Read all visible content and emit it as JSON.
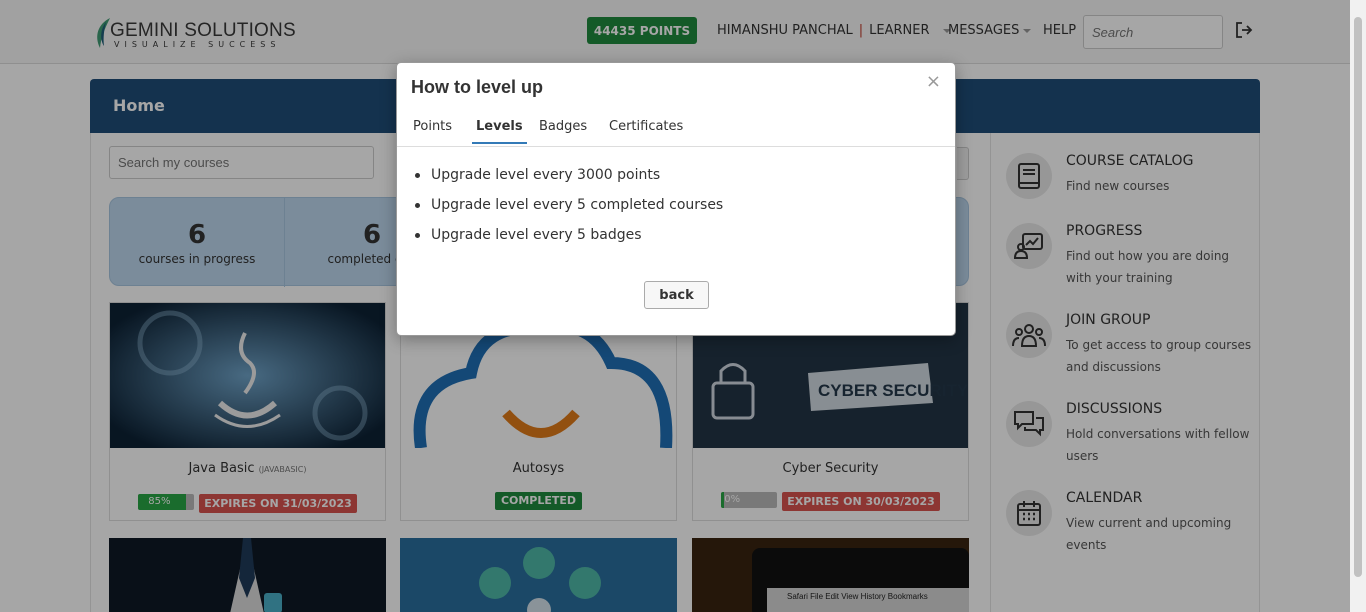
{
  "brand": {
    "name": "GEMINI SOLUTIONS",
    "tagline": "VISUALIZE SUCCESS"
  },
  "navbar": {
    "points_label": "44435 POINTS",
    "user_name": "HIMANSHU PANCHAL",
    "separator": "|",
    "user_role": "LEARNER",
    "messages_label": "MESSAGES",
    "help_label": "HELP",
    "search_placeholder": "Search"
  },
  "page": {
    "title": "Home",
    "course_search_placeholder": "Search my courses"
  },
  "stats": [
    {
      "value": "6",
      "label": "courses in progress"
    },
    {
      "value": "6",
      "label": "completed cou"
    }
  ],
  "courses": [
    {
      "title": "Java Basic",
      "code": "(JAVABASIC)",
      "progress_label": "85%",
      "progress": 0.85,
      "expiry": "EXPIRES ON 31/03/2023"
    },
    {
      "title": "Autosys",
      "status": "COMPLETED"
    },
    {
      "title": "Cyber Security",
      "progress_label": "0%",
      "progress": 0.0,
      "expiry": "EXPIRES ON 30/03/2023"
    }
  ],
  "sidebar": [
    {
      "icon": "book-icon",
      "title": "COURSE CATALOG",
      "desc": "Find new courses"
    },
    {
      "icon": "progress-chart-icon",
      "title": "PROGRESS",
      "desc": "Find out how you are doing with your training"
    },
    {
      "icon": "group-icon",
      "title": "JOIN GROUP",
      "desc": "To get access to group courses and discussions"
    },
    {
      "icon": "chat-bubbles-icon",
      "title": "DISCUSSIONS",
      "desc": "Hold conversations with fellow users"
    },
    {
      "icon": "calendar-icon",
      "title": "CALENDAR",
      "desc": "View current and upcoming events"
    }
  ],
  "modal": {
    "title": "How to level up",
    "close": "×",
    "tabs": [
      "Points",
      "Levels",
      "Badges",
      "Certificates"
    ],
    "active_tab": "Levels",
    "items": [
      "Upgrade level every 3000 points",
      "Upgrade level every 5 completed courses",
      "Upgrade level every 5 badges"
    ],
    "back_label": "back"
  },
  "colors": {
    "primary": "#1f4e79",
    "points": "#1f8a3e",
    "expires": "#d9534f",
    "stats_bg": "#bdd7ee"
  }
}
